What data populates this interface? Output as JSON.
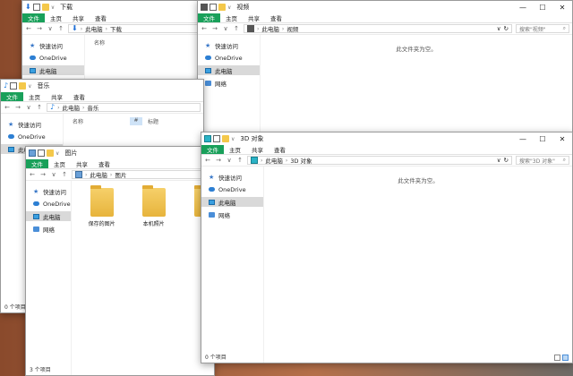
{
  "windows": {
    "downloads": {
      "title": "下载",
      "tabs": [
        "文件",
        "主页",
        "共享",
        "查看"
      ],
      "path": [
        "此电脑",
        "下载"
      ],
      "nav": [
        "快速访问",
        "OneDrive",
        "此电脑"
      ],
      "column_name": "名称"
    },
    "videos": {
      "title": "视频",
      "tabs": [
        "文件",
        "主页",
        "共享",
        "查看"
      ],
      "path": [
        "此电脑",
        "视频"
      ],
      "search_placeholder": "搜索\"视频\"",
      "nav": [
        "快速访问",
        "OneDrive",
        "此电脑",
        "网络"
      ],
      "empty_text": "此文件夹为空。"
    },
    "music": {
      "title": "音乐",
      "tabs": [
        "文件",
        "主页",
        "共享",
        "查看"
      ],
      "path": [
        "此电脑",
        "音乐"
      ],
      "nav": [
        "快速访问",
        "OneDrive",
        "此电脑"
      ],
      "column_name": "名称",
      "column_num": "#",
      "column_title": "标题",
      "status": "0 个项目"
    },
    "pictures": {
      "title": "图片",
      "tabs": [
        "文件",
        "主页",
        "共享",
        "查看"
      ],
      "path": [
        "此电脑",
        "图片"
      ],
      "nav": [
        "快速访问",
        "OneDrive",
        "此电脑",
        "网络"
      ],
      "folders": [
        "保存的图片",
        "本机照片",
        "屏"
      ],
      "status": "3 个项目"
    },
    "objects3d": {
      "title": "3D 对象",
      "tabs": [
        "文件",
        "主页",
        "共享",
        "查看"
      ],
      "path": [
        "此电脑",
        "3D 对象"
      ],
      "search_placeholder": "搜索\"3D 对象\"",
      "nav": [
        "快速访问",
        "OneDrive",
        "此电脑",
        "网络"
      ],
      "empty_text": "此文件夹为空。",
      "status": "0 个项目"
    }
  },
  "icons": {
    "minimize": "—",
    "maximize": "☐",
    "close": "✕",
    "back": "←",
    "forward": "→",
    "dropdown": "∨",
    "up": "↑",
    "refresh": "↻",
    "search": "⌕",
    "star": "★"
  },
  "colors": {
    "file_tab": "#19a05a",
    "selected_nav": "#d9d9d9",
    "folder": "#f4c84a"
  }
}
